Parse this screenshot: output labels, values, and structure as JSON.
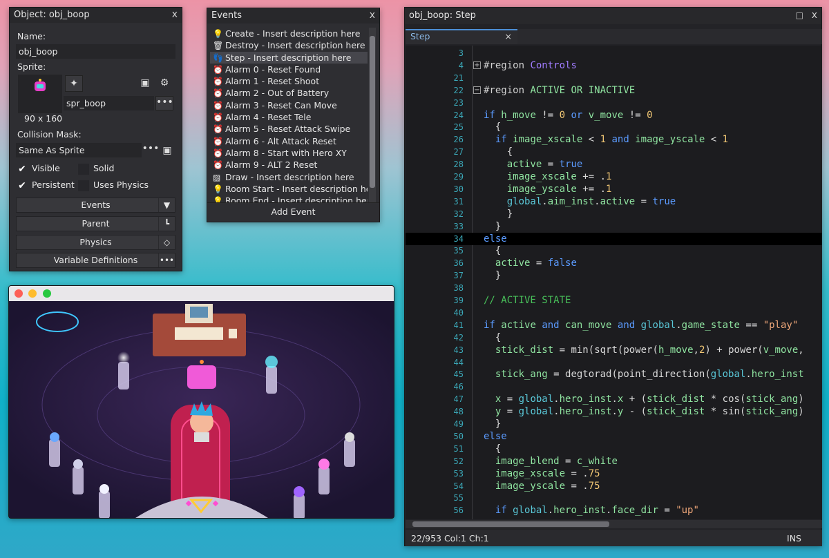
{
  "object_window": {
    "title": "Object: obj_boop",
    "name_label": "Name:",
    "name_value": "obj_boop",
    "sprite_label": "Sprite:",
    "sprite_name": "spr_boop",
    "sprite_size": "90 x 160",
    "collision_label": "Collision Mask:",
    "collision_value": "Same As Sprite",
    "checkboxes": [
      {
        "label": "Visible",
        "checked": true
      },
      {
        "label": "Solid",
        "checked": false
      },
      {
        "label": "Persistent",
        "checked": true
      },
      {
        "label": "Uses Physics",
        "checked": false
      }
    ],
    "buttons": [
      "Events",
      "Parent",
      "Physics",
      "Variable Definitions"
    ]
  },
  "events_window": {
    "title": "Events",
    "items": [
      "Create - Insert description here",
      "Destroy - Insert description here",
      "Step - Insert description here",
      "Alarm 0 - Reset Found",
      "Alarm 1 - Reset Shoot",
      "Alarm 2 - Out of Battery",
      "Alarm 3 - Reset Can Move",
      "Alarm 4 - Reset Tele",
      "Alarm 5 - Reset Attack Swipe",
      "Alarm 6 - Alt Attack Reset",
      "Alarm 8 - Start with Hero XY",
      "Alarm 9 - ALT 2 Reset",
      "Draw - Insert description here",
      "Room Start - Insert description he",
      "Room End - Insert description her"
    ],
    "add_button": "Add Event"
  },
  "code_window": {
    "title": "obj_boop: Step",
    "tab_label": "Step",
    "status_left": "22/953 Col:1 Ch:1",
    "status_right": "INS",
    "lines": [
      {
        "n": "3",
        "t": ""
      },
      {
        "n": "4",
        "t": "#region Controls"
      },
      {
        "n": "21",
        "t": ""
      },
      {
        "n": "22",
        "t": "#region ACTIVE OR INACTIVE"
      },
      {
        "n": "23",
        "t": ""
      },
      {
        "n": "24",
        "t": "if h_move != 0 or v_move != 0"
      },
      {
        "n": "25",
        "t": "  {"
      },
      {
        "n": "26",
        "t": "  if image_xscale < 1 and image_yscale < 1"
      },
      {
        "n": "27",
        "t": "    {"
      },
      {
        "n": "28",
        "t": "    active = true"
      },
      {
        "n": "29",
        "t": "    image_xscale += .1"
      },
      {
        "n": "30",
        "t": "    image_yscale += .1"
      },
      {
        "n": "31",
        "t": "    global.aim_inst.active = true"
      },
      {
        "n": "32",
        "t": "    }"
      },
      {
        "n": "33",
        "t": "  }"
      },
      {
        "n": "34",
        "t": "else"
      },
      {
        "n": "35",
        "t": "  {"
      },
      {
        "n": "36",
        "t": "  active = false"
      },
      {
        "n": "37",
        "t": "  }"
      },
      {
        "n": "38",
        "t": ""
      },
      {
        "n": "39",
        "t": "// ACTIVE STATE"
      },
      {
        "n": "40",
        "t": ""
      },
      {
        "n": "41",
        "t": "if active and can_move and global.game_state == \"play\""
      },
      {
        "n": "42",
        "t": "  {"
      },
      {
        "n": "43",
        "t": "  stick_dist = min(sqrt(power(h_move,2) + power(v_move,"
      },
      {
        "n": "44",
        "t": ""
      },
      {
        "n": "45",
        "t": "  stick_ang = degtorad(point_direction(global.hero_inst"
      },
      {
        "n": "46",
        "t": ""
      },
      {
        "n": "47",
        "t": "  x = global.hero_inst.x + (stick_dist * cos(stick_ang)"
      },
      {
        "n": "48",
        "t": "  y = global.hero_inst.y - (stick_dist * sin(stick_ang)"
      },
      {
        "n": "49",
        "t": "  }"
      },
      {
        "n": "50",
        "t": "else"
      },
      {
        "n": "51",
        "t": "  {"
      },
      {
        "n": "52",
        "t": "  image_blend = c_white"
      },
      {
        "n": "53",
        "t": "  image_xscale = .75"
      },
      {
        "n": "54",
        "t": "  image_yscale = .75"
      },
      {
        "n": "55",
        "t": ""
      },
      {
        "n": "56",
        "t": "  if global.hero_inst.face_dir = \"up\""
      }
    ]
  }
}
